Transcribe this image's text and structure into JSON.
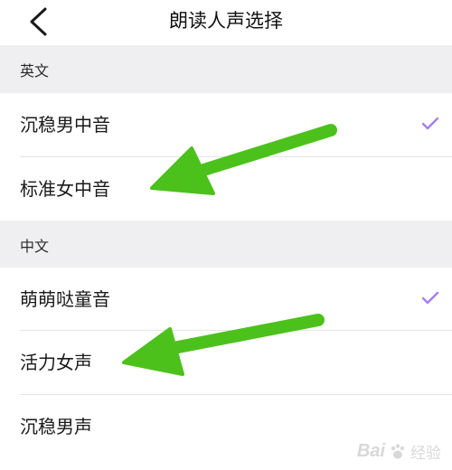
{
  "header": {
    "title": "朗读人声选择",
    "back_icon": "chevron-left-icon"
  },
  "sections": [
    {
      "label": "英文",
      "items": [
        {
          "label": "沉稳男中音",
          "selected": true
        },
        {
          "label": "标准女中音",
          "selected": false
        }
      ]
    },
    {
      "label": "中文",
      "items": [
        {
          "label": "萌萌哒童音",
          "selected": true
        },
        {
          "label": "活力女声",
          "selected": false
        },
        {
          "label": "沉稳男声",
          "selected": false
        }
      ]
    }
  ],
  "colors": {
    "check": "#a57ef0",
    "arrow": "#4cc11c",
    "section_bg": "#efeff1"
  },
  "watermark": {
    "logo": "Bai",
    "paw": "paw-icon",
    "text": "经验"
  }
}
